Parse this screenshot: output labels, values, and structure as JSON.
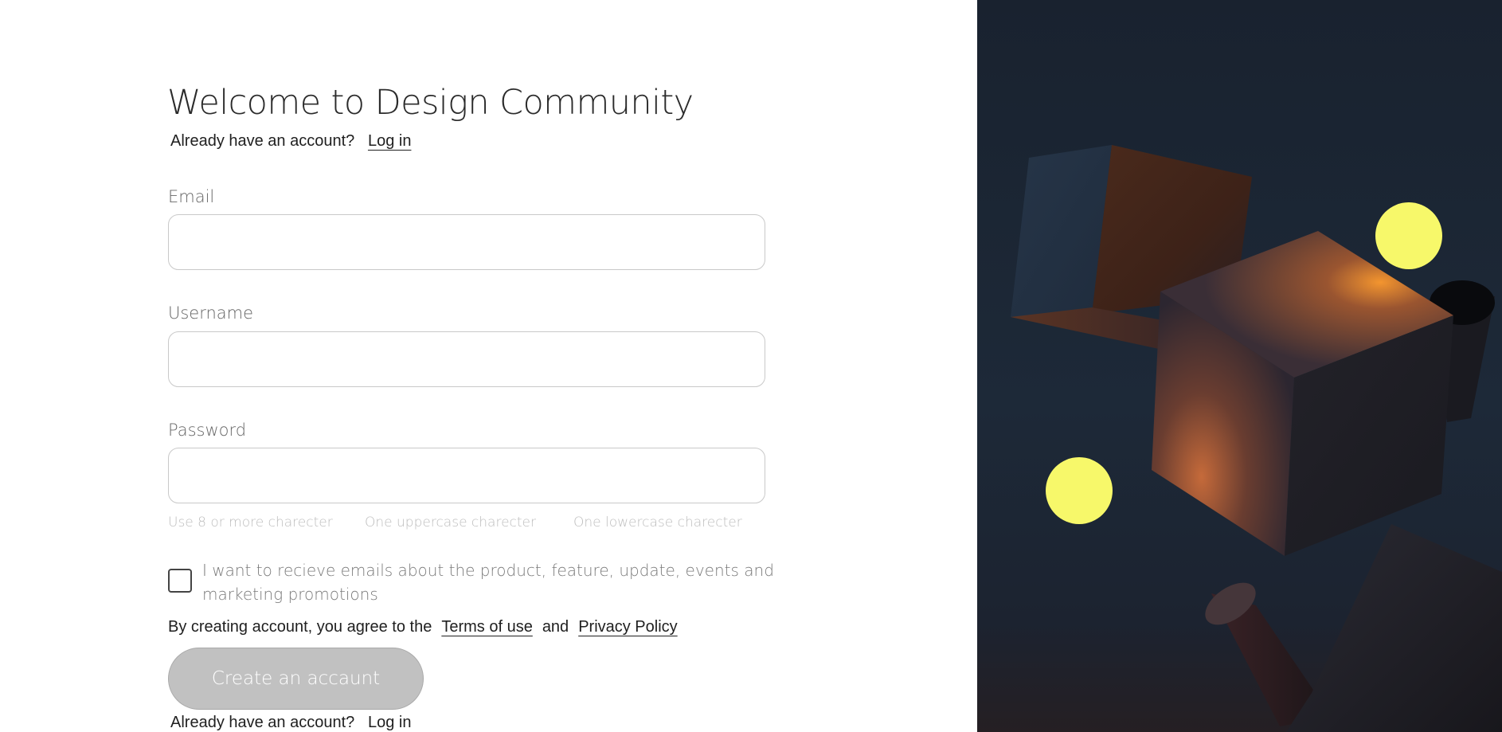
{
  "page": {
    "title": "Welcome to Design Community",
    "top_login_prompt": "Already have an account?",
    "top_login_link": "Log in"
  },
  "form": {
    "email": {
      "label": "Email",
      "value": "",
      "placeholder": ""
    },
    "username": {
      "label": "Username",
      "value": "",
      "placeholder": ""
    },
    "password": {
      "label": "Password",
      "value": "",
      "placeholder": ""
    },
    "password_hints": [
      "Use 8 or more charecter",
      "One uppercase charecter",
      "One lowercase charecter"
    ],
    "marketing_opt_in": {
      "checked": false,
      "label": "I want to recieve emails about the product, feature, update, events and marketing promotions"
    },
    "terms": {
      "prefix": "By creating account, you agree to the",
      "terms_link": "Terms of use",
      "conjunction": "and",
      "privacy_link": "Privacy Policy"
    },
    "submit_label": "Create an accaunt",
    "bottom_login_prompt": "Already have an account?",
    "bottom_login_link": "Log in"
  },
  "illustration": {
    "background_color": "#1b2533",
    "sphere_color": "#f7f86a",
    "accent_glow_color": "#f0882e"
  }
}
